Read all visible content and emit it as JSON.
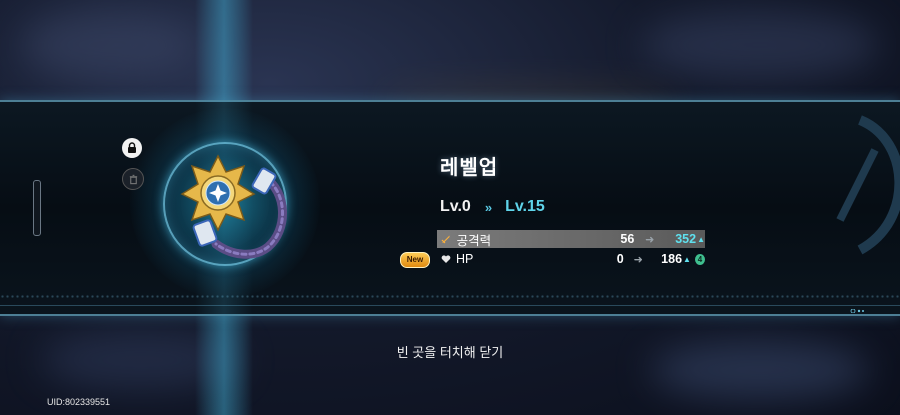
{
  "dialog": {
    "title": "레벨업",
    "level_from": "Lv.0",
    "level_arrow": "»",
    "level_to": "Lv.15"
  },
  "stats": [
    {
      "name": "공격력",
      "old": "56",
      "new": "352",
      "highlighted": true,
      "icon": "attack-sword-icon",
      "increase_arrow": true
    },
    {
      "name": "HP",
      "old": "0",
      "new": "186",
      "highlighted": false,
      "icon": "heart-icon",
      "increase_arrow": true,
      "bonus_badge": "4"
    }
  ],
  "new_tag": "New",
  "hint": "빈 곳을 터치해 닫기",
  "uid": "UID:802339551",
  "side_buttons": [
    {
      "icon": "lock-icon",
      "state": "locked"
    },
    {
      "icon": "trash-icon",
      "state": "disabled"
    }
  ],
  "colors": {
    "accent_cyan": "#5fd4ea",
    "panel_border": "#4d7f95",
    "new_tag": "#f0a020",
    "bonus_badge": "#3fbf8f"
  }
}
